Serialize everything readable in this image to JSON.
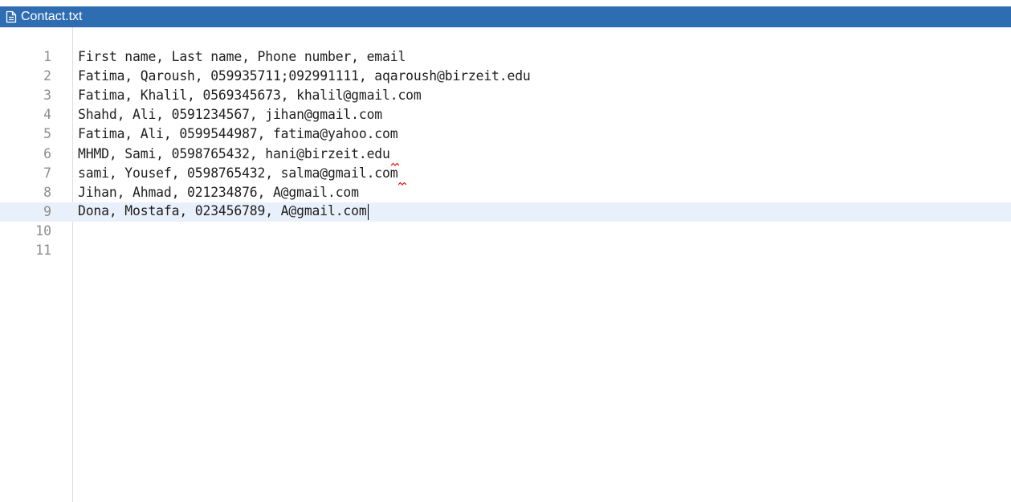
{
  "tab": {
    "title": "Contact.txt",
    "icon": "file-text-icon",
    "color": "#2f6db3"
  },
  "editor": {
    "current_line": 9,
    "lines": [
      {
        "number": "1",
        "text": "First name, Last name, Phone number, email"
      },
      {
        "number": "2",
        "text": "Fatima, Qaroush, 059935711;092991111, aqaroush@birzeit.edu"
      },
      {
        "number": "3",
        "text": "Fatima, Khalil, 0569345673, khalil@gmail.com"
      },
      {
        "number": "4",
        "text": "Shahd, Ali, 0591234567, jihan@gmail.com"
      },
      {
        "number": "5",
        "text": "Fatima, Ali, 0599544987, fatima@yahoo.com"
      },
      {
        "number": "6",
        "text": "MHMD, Sami, 0598765432, hani@birzeit.edu",
        "spellcheck_warning": true
      },
      {
        "number": "7",
        "text": "sami, Yousef, 0598765432, salma@gmail.com",
        "spellcheck_warning": true
      },
      {
        "number": "8",
        "text": "Jihan, Ahmad, 021234876, A@gmail.com"
      },
      {
        "number": "9",
        "text": "Dona, Mostafa, 023456789, A@gmail.com"
      },
      {
        "number": "10",
        "text": ""
      },
      {
        "number": "11",
        "text": ""
      }
    ]
  }
}
